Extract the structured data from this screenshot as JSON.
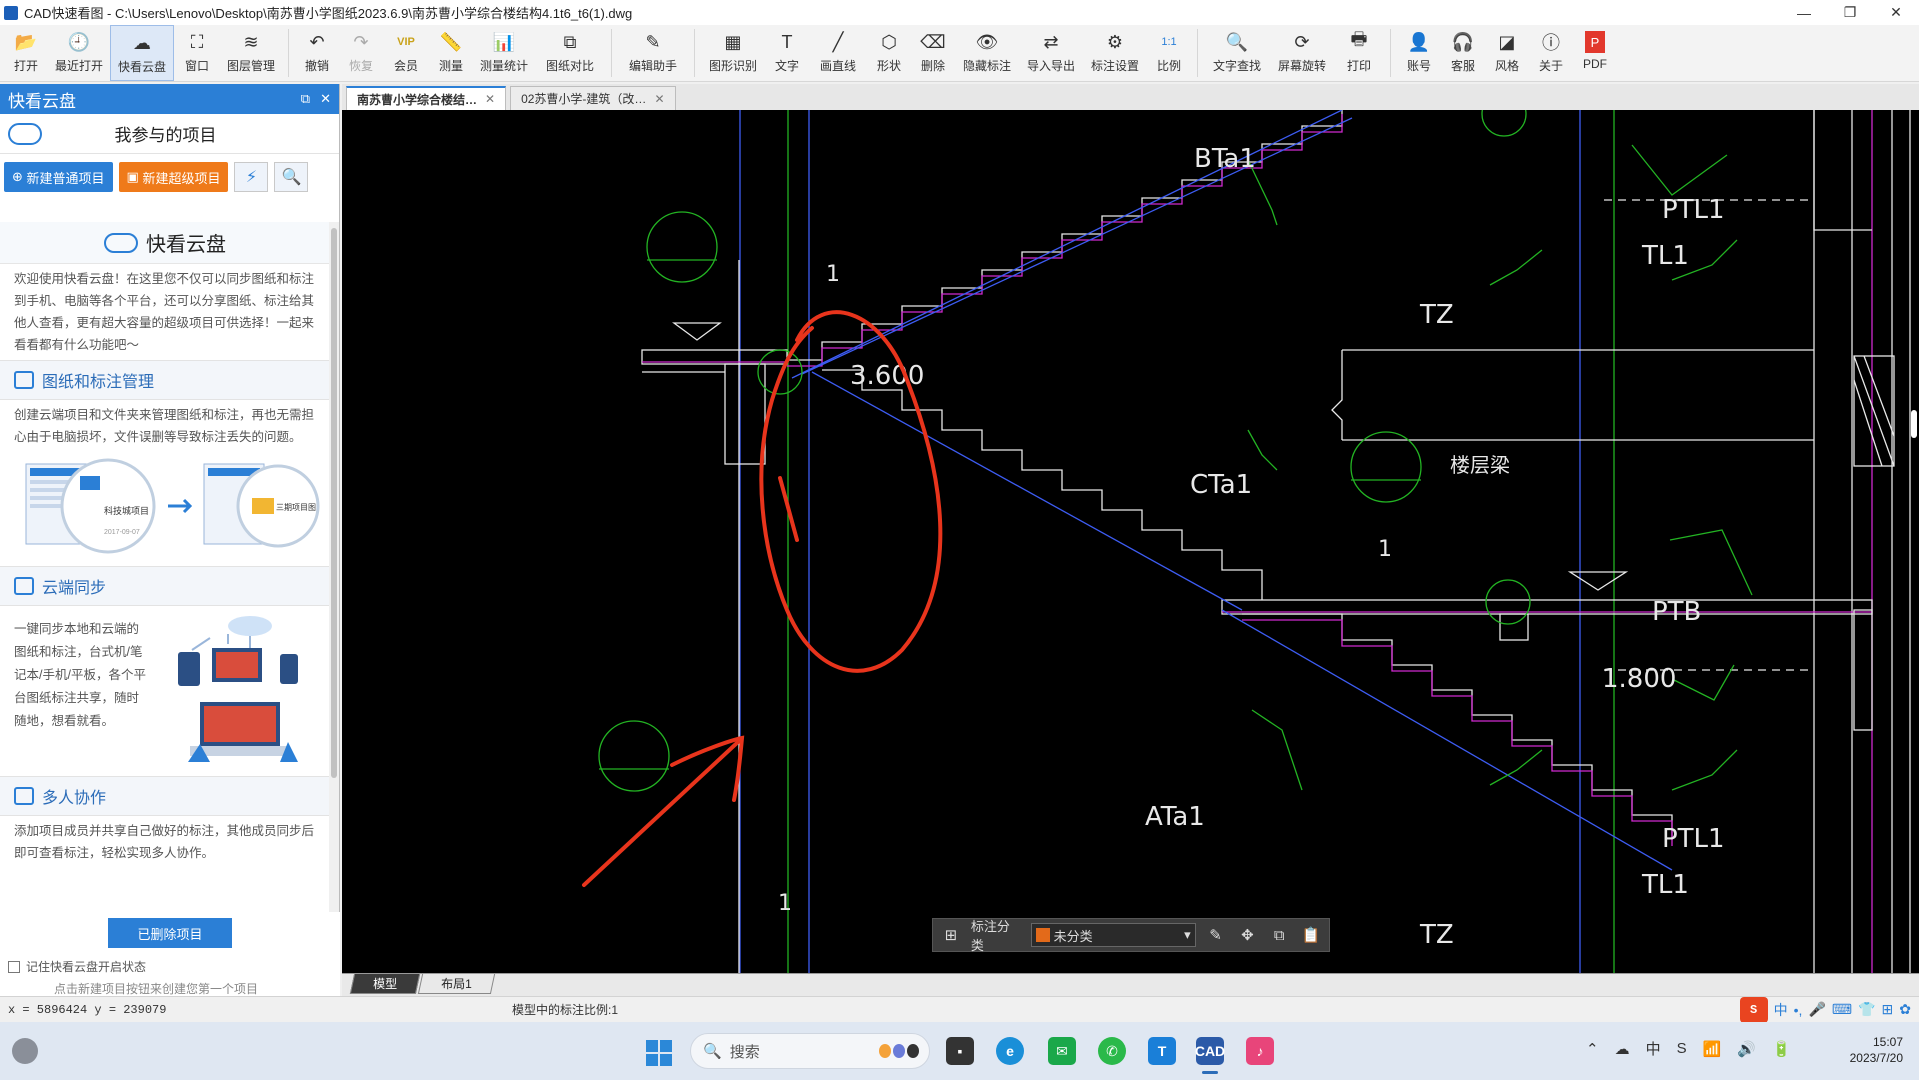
{
  "window": {
    "title": "CAD快速看图 - C:\\Users\\Lenovo\\Desktop\\南苏曹小学图纸2023.6.9\\南苏曹小学综合楼结构4.1t6_t6(1).dwg",
    "minimize": "—",
    "maximize": "❐",
    "close": "✕"
  },
  "toolbar": {
    "items": [
      {
        "label": "打开",
        "icon": "📂"
      },
      {
        "label": "最近打开",
        "icon": "🕘"
      },
      {
        "label": "快看云盘",
        "icon": "☁"
      },
      {
        "label": "窗口",
        "icon": "⛶"
      },
      {
        "label": "图层管理",
        "icon": "≋"
      },
      {
        "label": "撤销",
        "icon": "↶"
      },
      {
        "label": "恢复",
        "icon": "↷"
      },
      {
        "label": "会员",
        "icon": "VIP"
      },
      {
        "label": "测量",
        "icon": "📏"
      },
      {
        "label": "测量统计",
        "icon": "📊"
      },
      {
        "label": "图纸对比",
        "icon": "⧉"
      },
      {
        "label": "编辑助手",
        "icon": "✎"
      },
      {
        "label": "图形识别",
        "icon": "▦"
      },
      {
        "label": "文字",
        "icon": "T"
      },
      {
        "label": "画直线",
        "icon": "╱"
      },
      {
        "label": "形状",
        "icon": "⬡"
      },
      {
        "label": "删除",
        "icon": "⌫"
      },
      {
        "label": "隐藏标注",
        "icon": "👁"
      },
      {
        "label": "导入导出",
        "icon": "⇄"
      },
      {
        "label": "标注设置",
        "icon": "⚙"
      },
      {
        "label": "比例",
        "icon": "1:1"
      },
      {
        "label": "文字查找",
        "icon": "🔍"
      },
      {
        "label": "屏幕旋转",
        "icon": "⟳"
      },
      {
        "label": "打印",
        "icon": "🖶"
      },
      {
        "label": "账号",
        "icon": "👤"
      },
      {
        "label": "客服",
        "icon": "🎧"
      },
      {
        "label": "风格",
        "icon": "◪"
      },
      {
        "label": "关于",
        "icon": "ⓘ"
      },
      {
        "label": "PDF",
        "icon": "P"
      }
    ]
  },
  "leftpanel": {
    "header": "快看云盘",
    "subtitle": "我参与的项目",
    "btn_new_normal": "新建普通项目",
    "btn_new_super": "新建超级项目",
    "brand": "快看云盘",
    "intro": "欢迎使用快看云盘！在这里您不仅可以同步图纸和标注到手机、电脑等各个平台，还可以分享图纸、标注给其他人查看，更有超大容量的超级项目可供选择！一起来看看都有什么功能吧～",
    "sections": [
      {
        "title": "图纸和标注管理",
        "text": "创建云端项目和文件夹来管理图纸和标注，再也无需担心由于电脑损坏，文件误删等导致标注丢失的问题。"
      },
      {
        "title": "云端同步",
        "text": "一键同步本地和云端的图纸和标注，台式机/笔记本/手机/平板，各个平台图纸标注共享，随时随地，想看就看。"
      },
      {
        "title": "多人协作",
        "text": "添加项目成员并共享自己做好的标注，其他成员同步后即可查看标注，轻松实现多人协作。"
      }
    ],
    "illus_texts": [
      "科技城项目",
      "三期项目图",
      "2017-09-07"
    ],
    "deleted_btn": "已删除项目",
    "remember": "记住快看云盘开启状态",
    "hint": "点击新建项目按钮来创建您第一个项目"
  },
  "tabs": [
    {
      "label": "南苏曹小学综合楼结…",
      "active": true
    },
    {
      "label": "02苏曹小学-建筑（改…",
      "active": false
    }
  ],
  "drawing": {
    "labels": [
      "BTa1",
      "PTL1",
      "TL1",
      "TZ",
      "3.600",
      "CTa1",
      "楼层梁",
      "PTB",
      "1.800",
      "ATa1",
      "PTL1",
      "TL1",
      "TZ"
    ],
    "axis_marks": [
      "1",
      "1",
      "1"
    ],
    "colors": {
      "background": "#000000",
      "green": "#23b323",
      "blue": "#3d5cf2",
      "magenta": "#d02ad0",
      "white": "#e8e8e8",
      "red": "#e8341c"
    }
  },
  "annotation_bar": {
    "label": "标注分类",
    "select_value": "未分类"
  },
  "layout_tabs": [
    {
      "label": "模型",
      "active": true
    },
    {
      "label": "布局1",
      "active": false
    }
  ],
  "status": {
    "coords": "x = 5896424  y = 239079",
    "scale": "模型中的标注比例:1",
    "ime": [
      "中",
      "•,",
      "🎤",
      "⌨",
      "👕",
      "⊞",
      "✿"
    ]
  },
  "taskbar": {
    "search": "搜索",
    "tray": [
      "⌃",
      "☁",
      "中",
      "S",
      "📶",
      "🔊",
      "🔋"
    ],
    "time": "15:07",
    "date": "2023/7/20"
  }
}
